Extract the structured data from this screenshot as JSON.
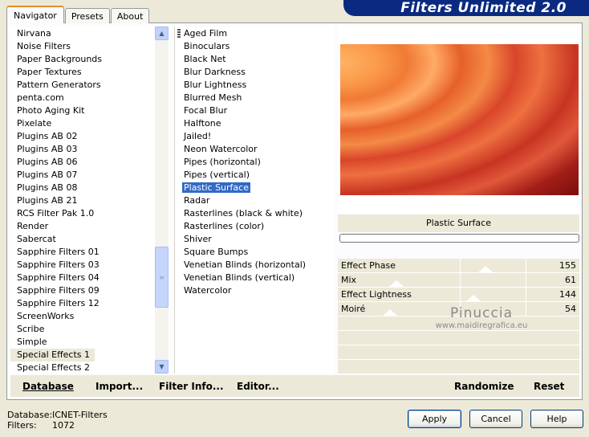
{
  "banner": {
    "title": "Filters Unlimited 2.0"
  },
  "tabs": [
    {
      "label": "Navigator",
      "active": true
    },
    {
      "label": "Presets"
    },
    {
      "label": "About"
    }
  ],
  "categories": [
    "Nirvana",
    "Noise Filters",
    "Paper Backgrounds",
    "Paper Textures",
    "Pattern Generators",
    "penta.com",
    "Photo Aging Kit",
    "Pixelate",
    "Plugins AB 02",
    "Plugins AB 03",
    "Plugins AB 06",
    "Plugins AB 07",
    "Plugins AB 08",
    "Plugins AB 21",
    "RCS Filter Pak 1.0",
    "Render",
    "Sabercat",
    "Sapphire Filters 01",
    "Sapphire Filters 03",
    "Sapphire Filters 04",
    "Sapphire Filters 09",
    "Sapphire Filters 12",
    "ScreenWorks",
    "Scribe",
    "Simple",
    "Special Effects 1",
    "Special Effects 2"
  ],
  "selected_category": "Special Effects 1",
  "filters": [
    "Aged Film",
    "Binoculars",
    "Black Net",
    "Blur Darkness",
    "Blur Lightness",
    "Blurred Mesh",
    "Focal Blur",
    "Halftone",
    "Jailed!",
    "Neon Watercolor",
    "Pipes (horizontal)",
    "Pipes (vertical)",
    "Plastic Surface",
    "Radar",
    "Rasterlines (black & white)",
    "Rasterlines (color)",
    "Shiver",
    "Square Bumps",
    "Venetian Blinds (horizontal)",
    "Venetian Blinds (vertical)",
    "Watercolor"
  ],
  "selected_filter": "Plastic Surface",
  "preview": {
    "filter_name": "Plastic Surface"
  },
  "params": [
    {
      "label": "Effect Phase",
      "value": "155"
    },
    {
      "label": "Mix",
      "value": "61"
    },
    {
      "label": "Effect Lightness",
      "value": "144"
    },
    {
      "label": "Moiré",
      "value": "54"
    }
  ],
  "links": {
    "database": "Database",
    "import": "Import...",
    "filter_info": "Filter Info...",
    "editor": "Editor...",
    "randomize": "Randomize",
    "reset": "Reset"
  },
  "status": {
    "database_label": "Database:",
    "database_value": "ICNET-Filters",
    "filters_label": "Filters:",
    "filters_value": "1072"
  },
  "buttons": {
    "apply": "Apply",
    "cancel": "Cancel",
    "help": "Help"
  },
  "watermark": {
    "name": "Pinuccia",
    "url": "www.maidiregrafica.eu"
  },
  "colors": {
    "banner": "#0a2a82",
    "selection": "#316ac5",
    "tab_accent": "#e68b2c"
  },
  "icons": {
    "scroll_up": "chevron-up-icon",
    "scroll_down": "chevron-down-icon"
  }
}
